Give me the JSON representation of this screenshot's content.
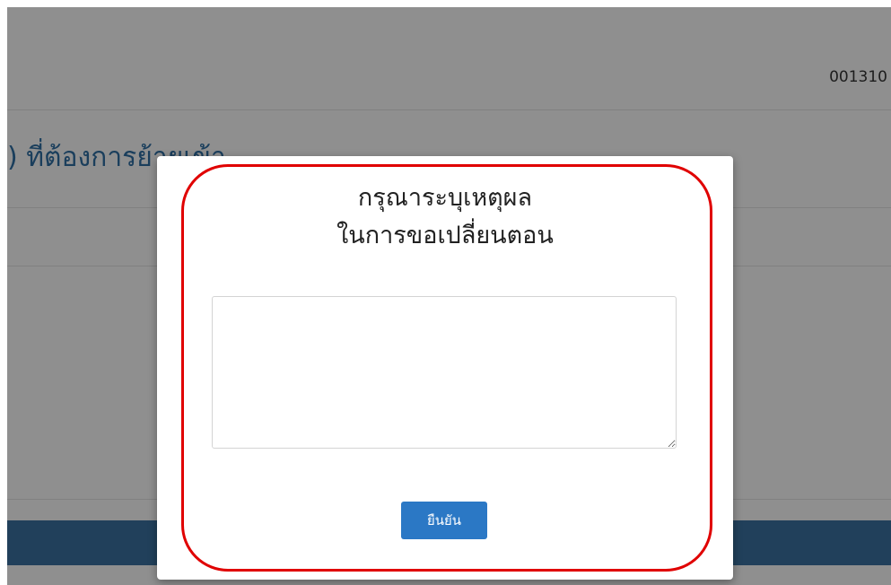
{
  "background": {
    "code_text": "001310",
    "heading_text": ") ที่ต้องการย้ายเข้า"
  },
  "modal": {
    "title_line1": "กรุณาระบุเหตุผล",
    "title_line2": "ในการขอเปลี่ยนตอน",
    "textarea_value": "",
    "confirm_label": "ยืนยัน"
  },
  "colors": {
    "accent_blue": "#2b78c5",
    "heading_blue": "#2d6b9f",
    "bar_blue": "#3a6f9e",
    "highlight_red": "#e00000"
  }
}
